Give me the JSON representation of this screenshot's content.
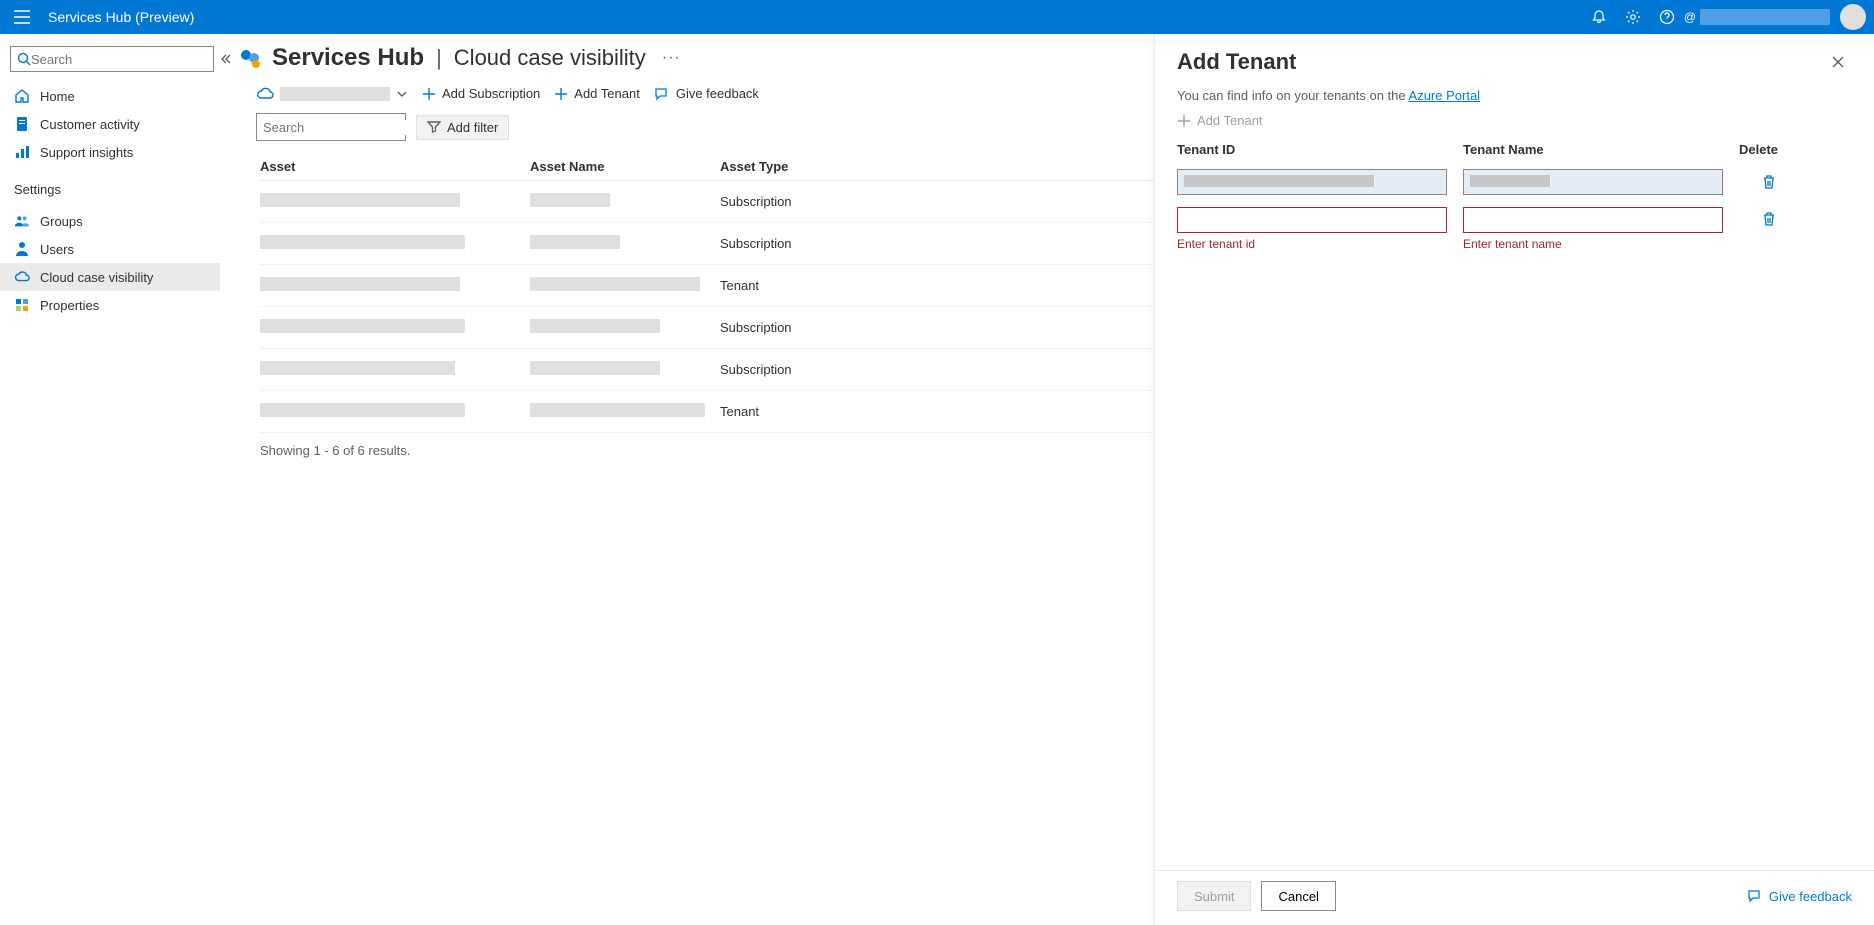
{
  "topbar": {
    "title": "Services Hub (Preview)",
    "user_at": "@"
  },
  "sidebar": {
    "search_placeholder": "Search",
    "items": [
      {
        "label": "Home",
        "icon": "home"
      },
      {
        "label": "Customer activity",
        "icon": "document"
      },
      {
        "label": "Support insights",
        "icon": "bar-chart"
      }
    ],
    "settings_label": "Settings",
    "settings_items": [
      {
        "label": "Groups",
        "icon": "people"
      },
      {
        "label": "Users",
        "icon": "person"
      },
      {
        "label": "Cloud case visibility",
        "icon": "cloud",
        "active": true
      },
      {
        "label": "Properties",
        "icon": "grid"
      }
    ]
  },
  "header": {
    "hub": "Services Hub",
    "page": "Cloud case visibility"
  },
  "toolbar": {
    "add_subscription": "Add Subscription",
    "add_tenant": "Add Tenant",
    "give_feedback": "Give feedback"
  },
  "filters": {
    "search_placeholder": "Search",
    "add_filter": "Add filter"
  },
  "table": {
    "columns": {
      "asset": "Asset",
      "asset_name": "Asset Name",
      "asset_type": "Asset Type"
    },
    "rows": [
      {
        "asset_w": 200,
        "name_w": 80,
        "type": "Subscription"
      },
      {
        "asset_w": 205,
        "name_w": 90,
        "type": "Subscription"
      },
      {
        "asset_w": 200,
        "name_w": 170,
        "type": "Tenant"
      },
      {
        "asset_w": 205,
        "name_w": 130,
        "type": "Subscription"
      },
      {
        "asset_w": 195,
        "name_w": 130,
        "type": "Subscription"
      },
      {
        "asset_w": 205,
        "name_w": 175,
        "type": "Tenant"
      }
    ],
    "results_text": "Showing 1 - 6 of 6 results."
  },
  "panel": {
    "title": "Add Tenant",
    "info_prefix": "You can find info on your tenants on the ",
    "info_link": "Azure Portal",
    "add_tenant_disabled": "Add Tenant",
    "columns": {
      "id": "Tenant ID",
      "name": "Tenant Name",
      "delete": "Delete"
    },
    "errors": {
      "id": "Enter tenant id",
      "name": "Enter tenant name"
    },
    "submit": "Submit",
    "cancel": "Cancel",
    "feedback": "Give feedback"
  }
}
